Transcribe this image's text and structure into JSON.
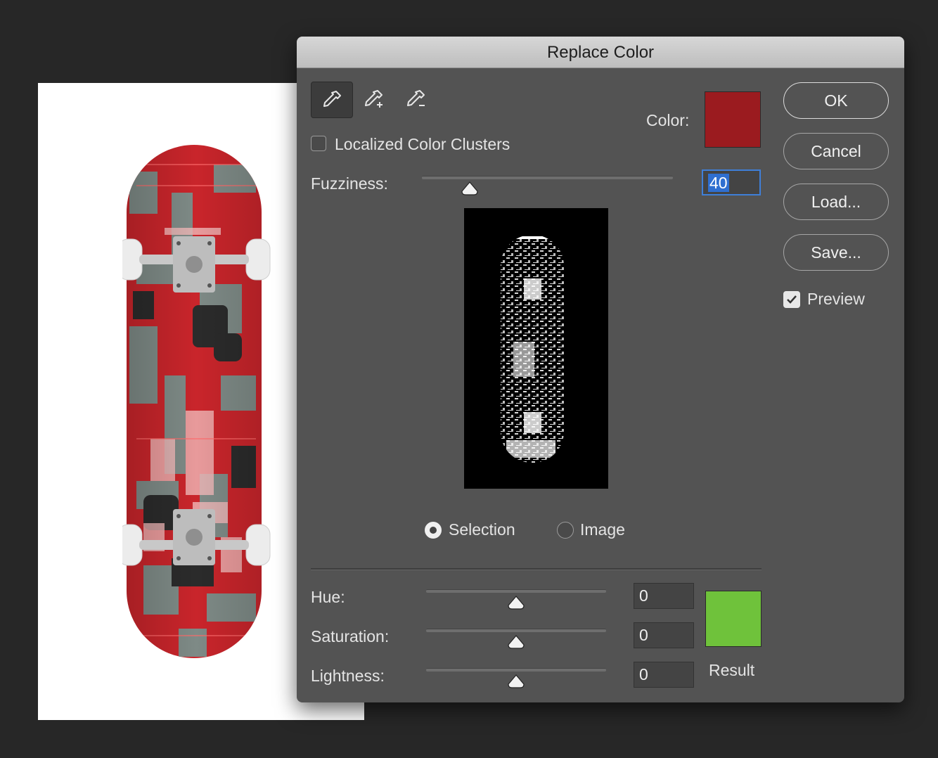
{
  "dialog": {
    "title": "Replace Color",
    "localized_label": "Localized Color Clusters",
    "localized_checked": false,
    "color_label": "Color:",
    "color_value": "#9b1b1f",
    "fuzziness_label": "Fuzziness:",
    "fuzziness_value": "40",
    "fuzziness_fraction": 0.19,
    "view_options": {
      "selection": "Selection",
      "image": "Image",
      "selected": "selection"
    },
    "hue": {
      "label": "Hue:",
      "value": "0",
      "fraction": 0.5
    },
    "saturation": {
      "label": "Saturation:",
      "value": "0",
      "fraction": 0.5
    },
    "lightness": {
      "label": "Lightness:",
      "value": "0",
      "fraction": 0.5
    },
    "result_label": "Result",
    "result_color": "#6fc23b",
    "buttons": {
      "ok": "OK",
      "cancel": "Cancel",
      "load": "Load...",
      "save": "Save..."
    },
    "preview_label": "Preview",
    "preview_checked": true,
    "tools": [
      "eyedropper-icon",
      "eyedropper-add-icon",
      "eyedropper-subtract-icon"
    ]
  }
}
